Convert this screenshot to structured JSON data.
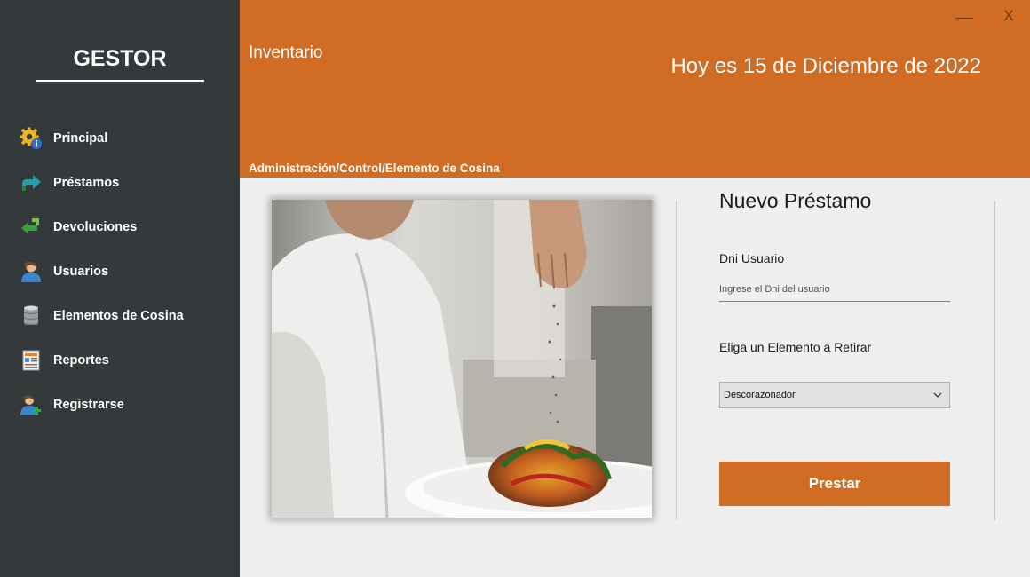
{
  "sidebar": {
    "brand": "GESTOR",
    "items": [
      {
        "label": "Principal",
        "icon": "gear-info-icon"
      },
      {
        "label": "Préstamos",
        "icon": "share-arrow-icon"
      },
      {
        "label": "Devoluciones",
        "icon": "return-arrow-icon"
      },
      {
        "label": "Usuarios",
        "icon": "user-icon"
      },
      {
        "label": "Elementos de Cosina",
        "icon": "database-icon"
      },
      {
        "label": "Reportes",
        "icon": "report-icon"
      },
      {
        "label": "Registrarse",
        "icon": "add-user-icon"
      }
    ]
  },
  "header": {
    "module_title": "Inventario",
    "date_text": "Hoy es 15 de Diciembre de 2022",
    "breadcrumb": "Administración/Control/Elemento de Cosina",
    "minimize_label": "—",
    "close_label": "X"
  },
  "form": {
    "title": "Nuevo Préstamo",
    "dni_label": "Dni Usuario",
    "dni_placeholder": "Ingrese el Dni del usuario",
    "element_label": "Eliga un Elemento a Retirar",
    "element_selected": "Descorazonador",
    "submit_label": "Prestar"
  },
  "colors": {
    "accent": "#d16c24",
    "sidebar_bg": "#343a3b",
    "content_bg": "#efefef"
  }
}
